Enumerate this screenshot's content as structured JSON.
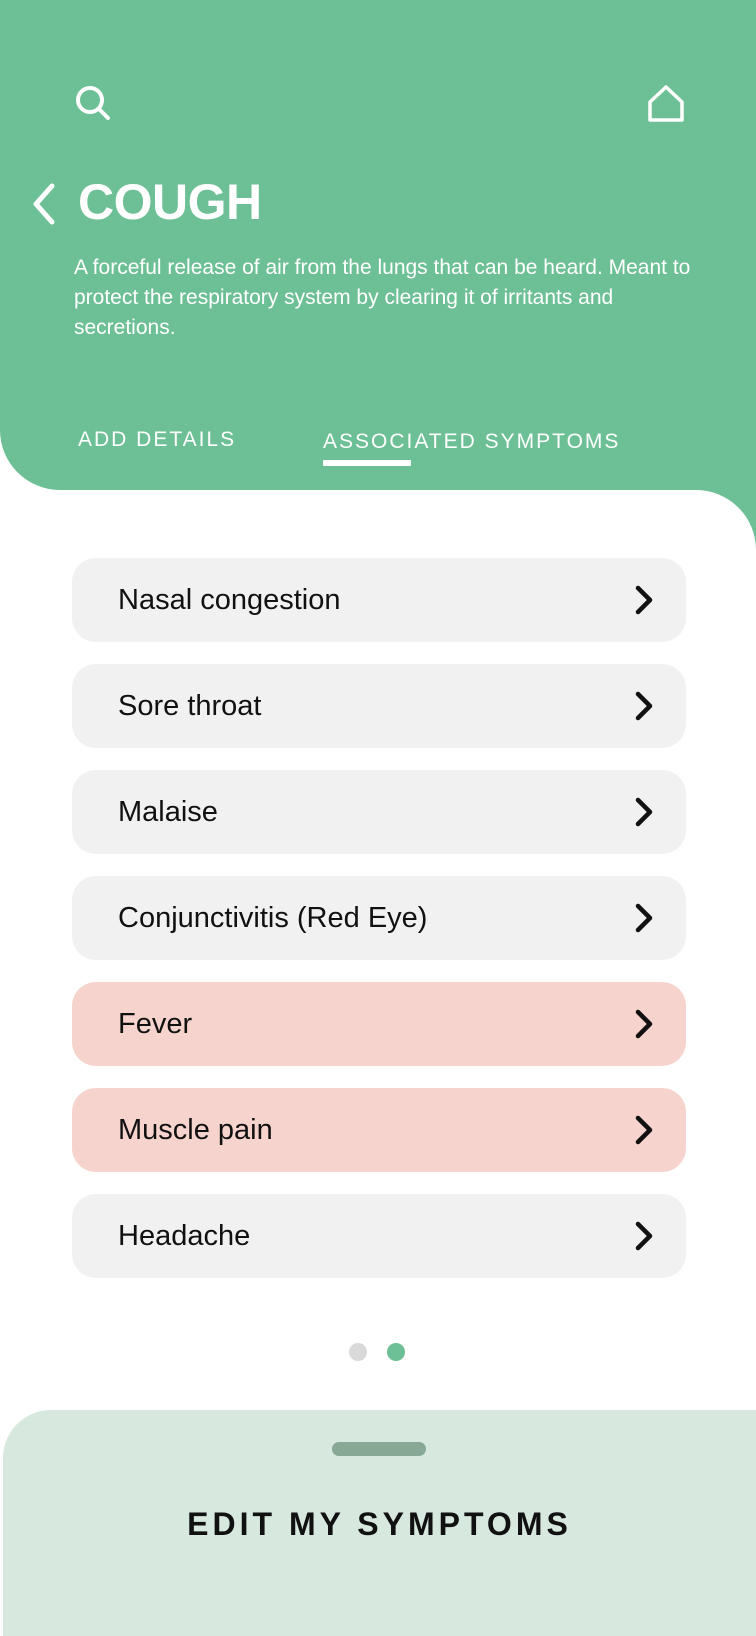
{
  "header": {
    "title": "COUGH",
    "description": "A forceful release of air from the lungs that can be heard. Meant to protect the respiratory system by clearing it of irritants and secretions.",
    "icons": {
      "search": "search-icon",
      "home": "home-icon",
      "back": "chevron-left-icon"
    }
  },
  "tabs": [
    {
      "label": "ADD DETAILS",
      "active": false
    },
    {
      "label": "ASSOCIATED SYMPTOMS",
      "active": true
    }
  ],
  "symptoms": [
    {
      "label": "Nasal congestion",
      "highlighted": false
    },
    {
      "label": "Sore throat",
      "highlighted": false
    },
    {
      "label": "Malaise",
      "highlighted": false
    },
    {
      "label": "Conjunctivitis (Red Eye)",
      "highlighted": false
    },
    {
      "label": "Fever",
      "highlighted": true
    },
    {
      "label": "Muscle pain",
      "highlighted": true
    },
    {
      "label": "Headache",
      "highlighted": false
    }
  ],
  "pagination": {
    "current": 2,
    "total": 2
  },
  "sheet": {
    "button_label": "EDIT MY SYMPTOMS"
  },
  "colors": {
    "accent": "#6dc095",
    "highlight_item": "#f6d4cd",
    "default_item": "#f1f1f1",
    "sheet": "#d7e8df"
  }
}
